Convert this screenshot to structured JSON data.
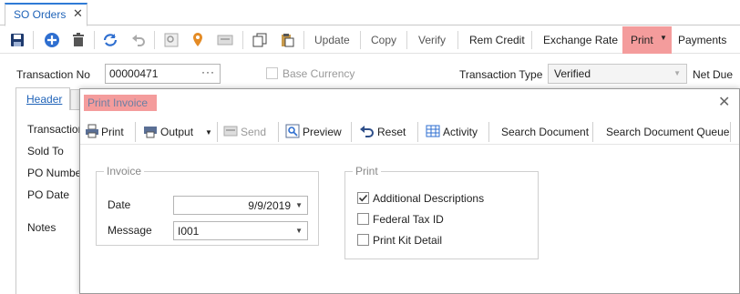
{
  "window": {
    "tab_label": "SO Orders",
    "tab_close": "✕"
  },
  "toolbar": {
    "update": "Update",
    "copy": "Copy",
    "verify": "Verify",
    "rem_credit": "Rem Credit",
    "exchange_rate": "Exchange Rate",
    "print": "Print",
    "payments": "Payments",
    "print_highlight": "#f49c9c"
  },
  "form": {
    "transaction_no_label": "Transaction No",
    "transaction_no_value": "00000471",
    "base_currency_label": "Base Currency",
    "transaction_type_label": "Transaction Type",
    "transaction_type_value": "Verified",
    "net_due_label": "Net Due",
    "header_tab": "Header",
    "left_labels": [
      "Transaction",
      "Sold To",
      "PO Number",
      "PO Date",
      "Notes"
    ]
  },
  "modal": {
    "title": "Print Invoice",
    "close": "✕",
    "toolbar": {
      "print": "Print",
      "output": "Output",
      "send": "Send",
      "preview": "Preview",
      "reset": "Reset",
      "activity": "Activity",
      "search_document": "Search Document",
      "search_document_queue": "Search Document Queue"
    },
    "invoice_group": {
      "legend": "Invoice",
      "date_label": "Date",
      "date_value": "9/9/2019",
      "message_label": "Message",
      "message_value": "I001"
    },
    "print_group": {
      "legend": "Print",
      "options": [
        {
          "label": "Additional Descriptions",
          "checked": true
        },
        {
          "label": "Federal Tax ID",
          "checked": false
        },
        {
          "label": "Print Kit Detail",
          "checked": false
        }
      ]
    }
  }
}
